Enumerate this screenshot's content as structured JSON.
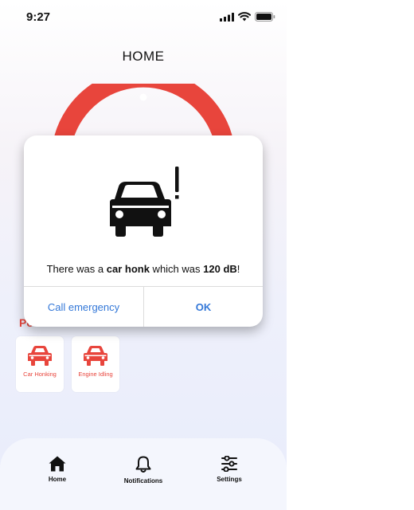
{
  "status_bar": {
    "time": "9:27"
  },
  "header": {
    "title": "HOME"
  },
  "gauge": {
    "color": "#e8453c"
  },
  "section": {
    "label": "Po"
  },
  "tiles": [
    {
      "label": "Car Honking",
      "icon": "car-icon"
    },
    {
      "label": "Engine Idling",
      "icon": "car-icon"
    }
  ],
  "alert": {
    "icon": "car-alert-icon",
    "message_prefix": "There was a ",
    "event": "car honk",
    "message_middle": " which was ",
    "level": "120 dB",
    "message_suffix": "!",
    "cancel_label": "Call emergency",
    "ok_label": "OK"
  },
  "tabbar": {
    "items": [
      {
        "label": "Home",
        "icon": "home-icon"
      },
      {
        "label": "Notifications",
        "icon": "bell-icon"
      },
      {
        "label": "Settings",
        "icon": "sliders-icon"
      }
    ]
  },
  "colors": {
    "accent": "#e8453c",
    "link": "#3478d8"
  }
}
